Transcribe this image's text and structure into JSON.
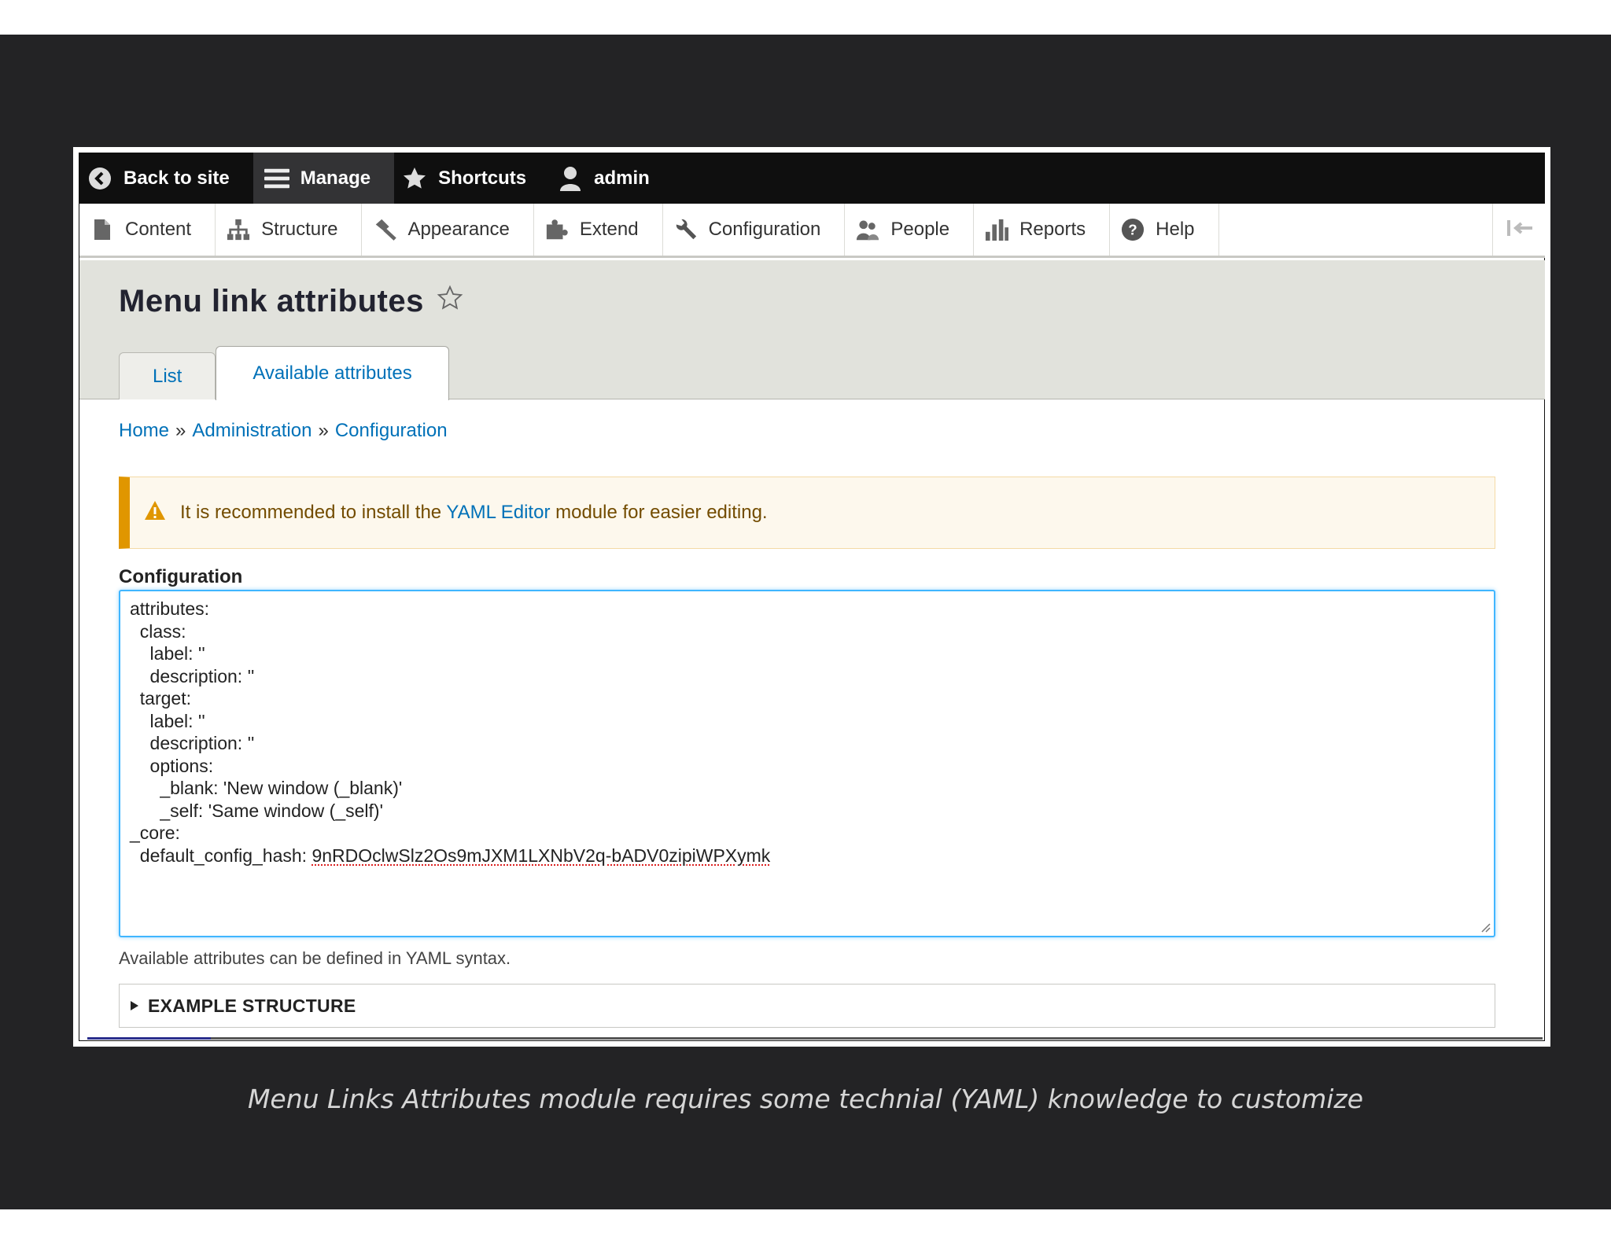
{
  "toolbar": {
    "back_to_site": "Back to site",
    "manage": "Manage",
    "shortcuts": "Shortcuts",
    "user": "admin"
  },
  "tray": {
    "items": [
      "Content",
      "Structure",
      "Appearance",
      "Extend",
      "Configuration",
      "People",
      "Reports",
      "Help"
    ]
  },
  "page": {
    "title": "Menu link attributes",
    "tabs": {
      "list": "List",
      "available": "Available attributes"
    }
  },
  "breadcrumb": {
    "home": "Home",
    "sep": "»",
    "admin": "Administration",
    "config": "Configuration"
  },
  "warning": {
    "before": "It is recommended to install the",
    "link": "YAML Editor",
    "after": "module for easier editing."
  },
  "config": {
    "label": "Configuration",
    "value": "attributes:\n  class:\n    label: ''\n    description: ''\n  target:\n    label: ''\n    description: ''\n    options:\n      _blank: 'New window (_blank)'\n      _self: 'Same window (_self)'\n_core:\n  default_config_hash: ",
    "hash": "9nRDOclwSlz2Os9mJXM1LXNbV2q-bADV0zipiWPXymk",
    "description": "Available attributes can be defined in YAML syntax."
  },
  "example": {
    "label": "EXAMPLE STRUCTURE"
  },
  "video": {
    "progress": 0.085
  },
  "caption": "Menu Links Attributes module requires some technial (YAML) knowledge to customize",
  "colors": {
    "link": "#0071b8",
    "focus": "#40b6ff",
    "warning_border": "#e09600",
    "toolbar_bg": "#0f0f0f"
  }
}
